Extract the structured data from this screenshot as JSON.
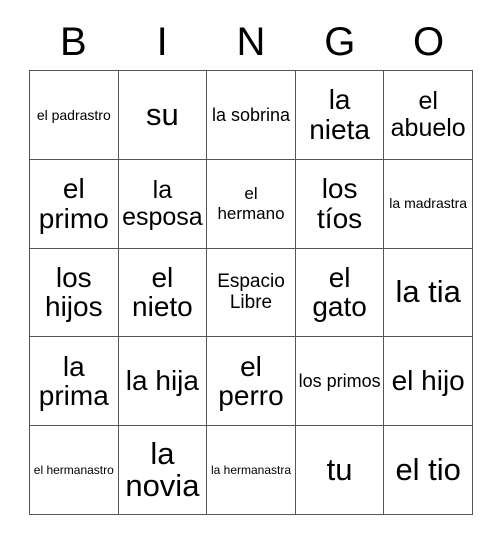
{
  "card": {
    "title_letters": [
      "B",
      "I",
      "N",
      "G",
      "O"
    ],
    "free_space_label": "Espacio Libre",
    "border_color": "#555555",
    "text_color": "#000000",
    "background_color": "#ffffff"
  },
  "grid": {
    "columns": 5,
    "rows": 5,
    "cells": [
      {
        "text": "el padrastro",
        "size": "fs-sm"
      },
      {
        "text": "su",
        "size": "fs-huge"
      },
      {
        "text": "la sobrina",
        "size": "fs-md2"
      },
      {
        "text": "la nieta",
        "size": "fs-xxl"
      },
      {
        "text": "el abuelo",
        "size": "fs-xl"
      },
      {
        "text": "el primo",
        "size": "fs-xxl"
      },
      {
        "text": "la esposa",
        "size": "fs-xl"
      },
      {
        "text": "el hermano",
        "size": "fs-md"
      },
      {
        "text": "los tíos",
        "size": "fs-xxl"
      },
      {
        "text": "la madrastra",
        "size": "fs-sm"
      },
      {
        "text": "los hijos",
        "size": "fs-xxl"
      },
      {
        "text": "el nieto",
        "size": "fs-xxl"
      },
      {
        "text": "Espacio Libre",
        "size": "fs-lg"
      },
      {
        "text": "el gato",
        "size": "fs-xxl"
      },
      {
        "text": "la tia",
        "size": "fs-huge"
      },
      {
        "text": "la prima",
        "size": "fs-xxl"
      },
      {
        "text": "la hija",
        "size": "fs-xxl"
      },
      {
        "text": "el perro",
        "size": "fs-xxl"
      },
      {
        "text": "los primos",
        "size": "fs-md2"
      },
      {
        "text": "el hijo",
        "size": "fs-xxl"
      },
      {
        "text": "el hermanastro",
        "size": "fs-xs"
      },
      {
        "text": "la novia",
        "size": "fs-huge"
      },
      {
        "text": "la hermanastra",
        "size": "fs-xs"
      },
      {
        "text": "tu",
        "size": "fs-huge"
      },
      {
        "text": "el tio",
        "size": "fs-huge"
      }
    ]
  }
}
